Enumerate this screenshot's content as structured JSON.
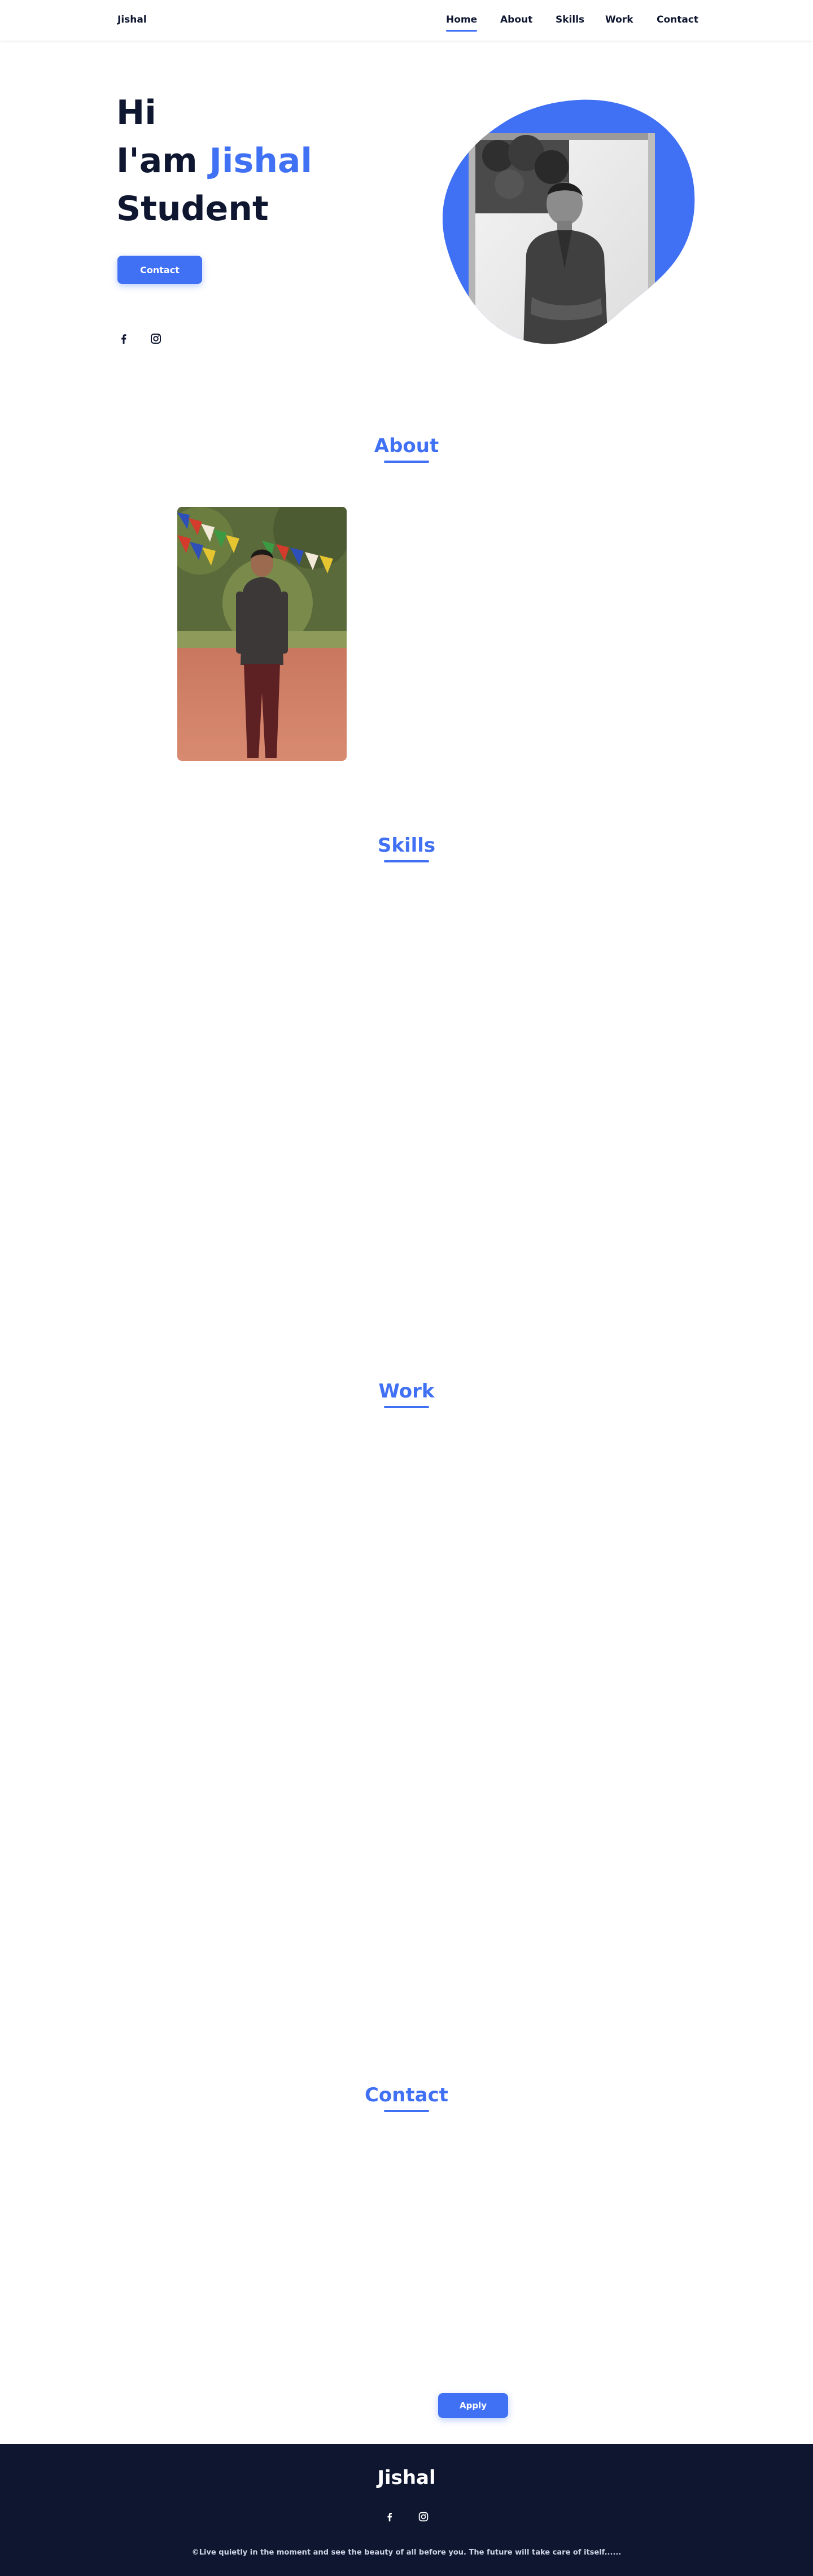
{
  "header": {
    "logo": "Jishal",
    "nav": [
      {
        "label": "Home",
        "active": true
      },
      {
        "label": "About",
        "active": false
      },
      {
        "label": "Skills",
        "active": false
      },
      {
        "label": "Work",
        "active": false
      },
      {
        "label": "Contact",
        "active": false
      }
    ]
  },
  "hero": {
    "line1": "Hi",
    "line2_prefix": "I'am ",
    "line2_name": "Jishal",
    "line3": "Student",
    "button_label": "Contact",
    "socials": [
      {
        "icon": "facebook-icon"
      },
      {
        "icon": "instagram-icon"
      }
    ],
    "image": "portrait-photo"
  },
  "about": {
    "title": "About",
    "image": "standing-photo"
  },
  "skills": {
    "title": "Skills"
  },
  "work": {
    "title": "Work"
  },
  "contact": {
    "title": "Contact",
    "apply_label": "Apply"
  },
  "footer": {
    "title": "Jishal",
    "socials": [
      {
        "icon": "facebook-icon"
      },
      {
        "icon": "instagram-icon"
      }
    ],
    "copyright": "©Live quietly in the moment and see the beauty of all before you. The future will take care of itself......"
  },
  "colors": {
    "accent": "#4070f4",
    "dark": "#0e1630",
    "background": "#ffffff"
  }
}
